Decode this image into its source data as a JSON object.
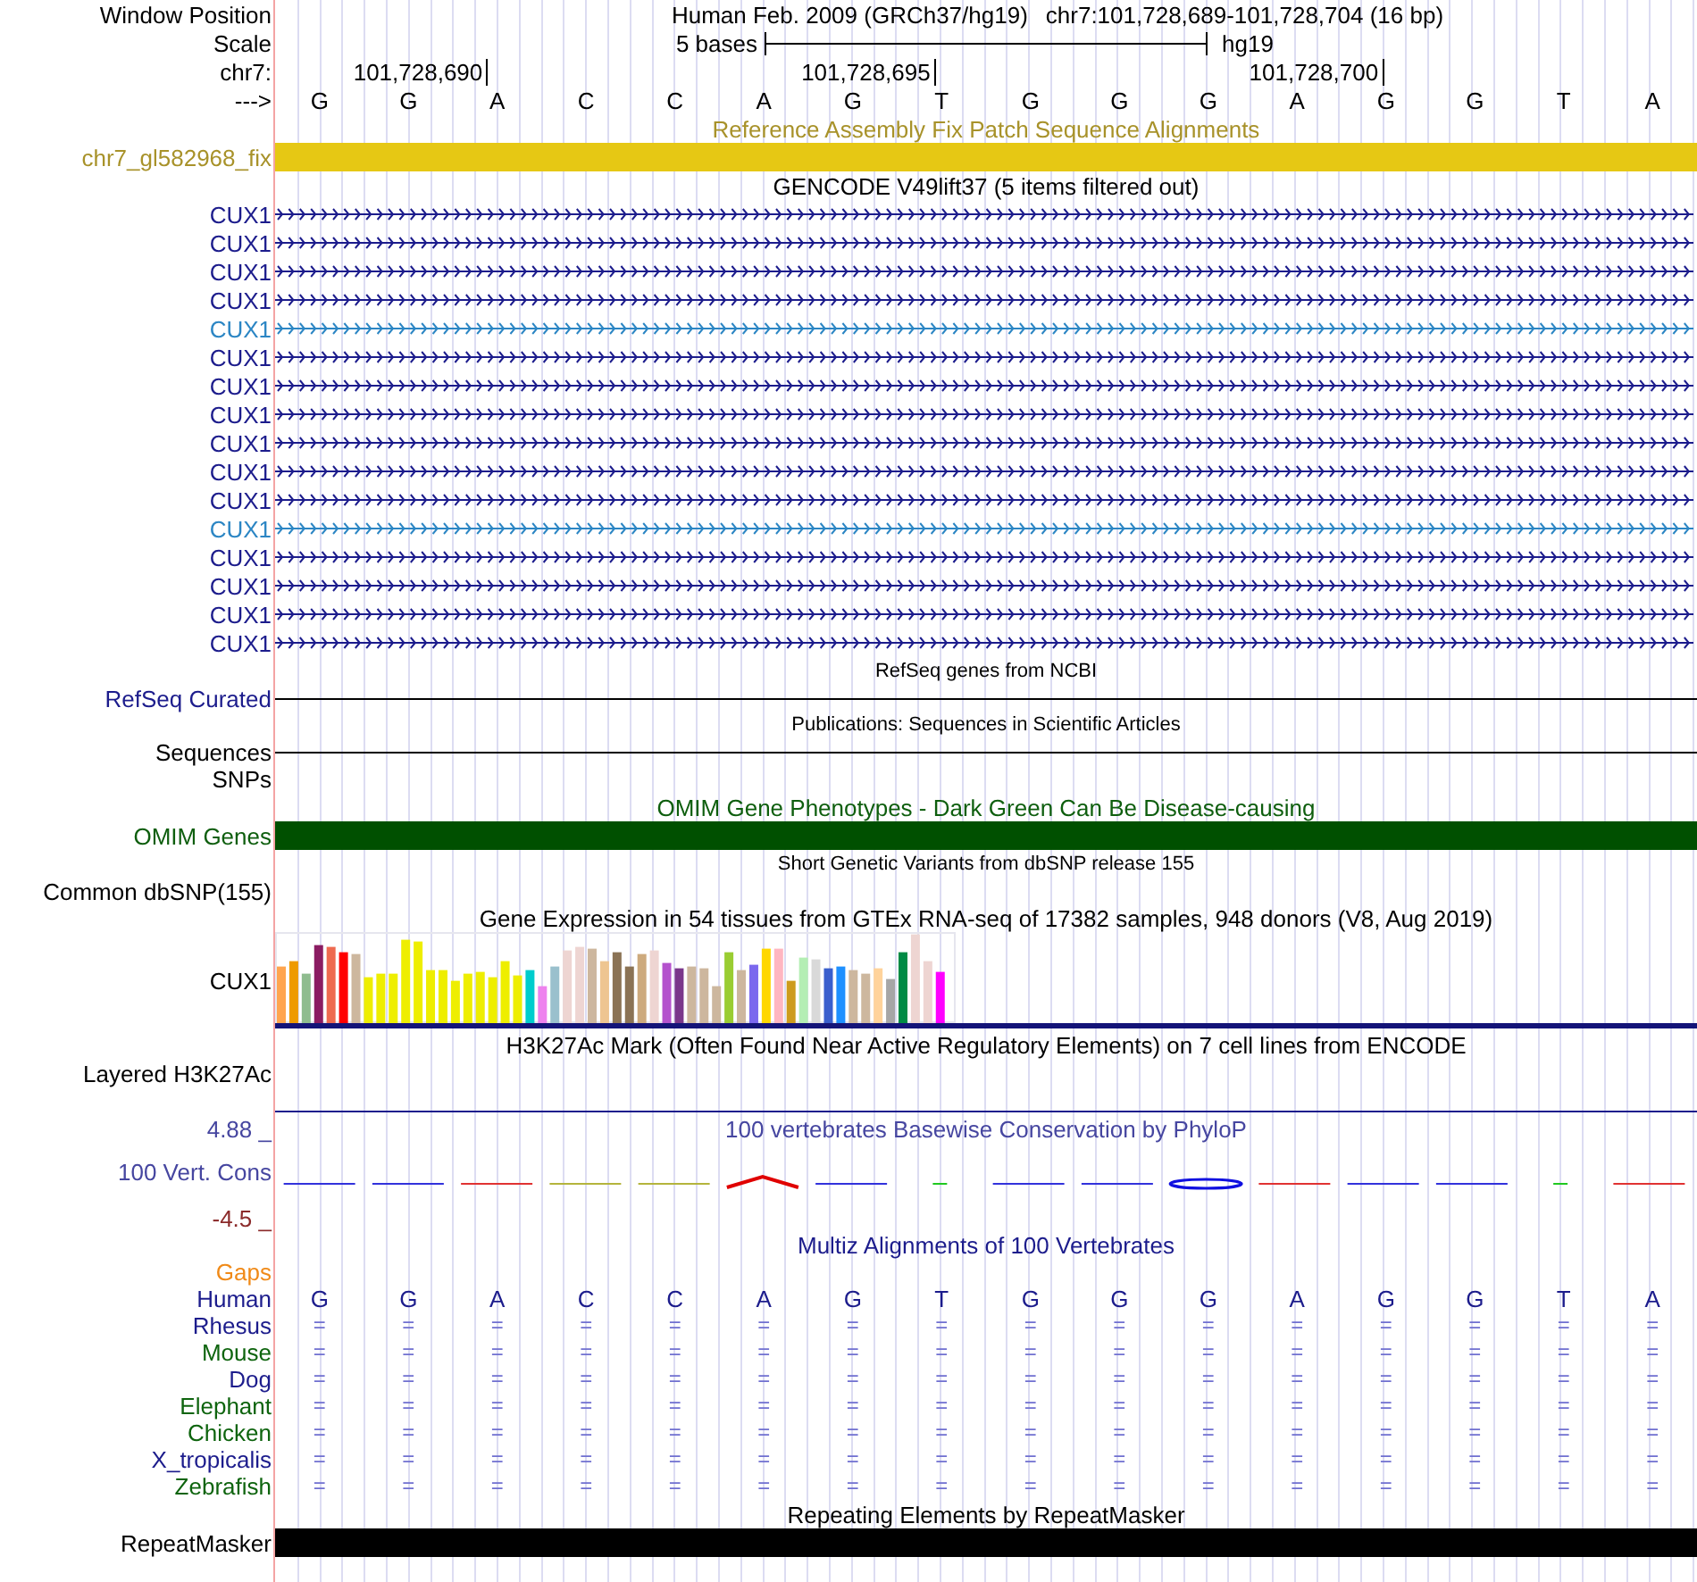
{
  "header": {
    "window_position_label": "Window Position",
    "assembly": "Human Feb. 2009 (GRCh37/hg19)",
    "position": "chr7:101,728,689-101,728,704 (16 bp)",
    "scale_label": "Scale",
    "scale_text": "5 bases",
    "scale_db": "hg19",
    "chrom_label": "chr7:",
    "ruler_ticks": [
      "101,728,690",
      "101,728,695",
      "101,728,700"
    ],
    "strand_label": "--->",
    "bases": [
      "G",
      "G",
      "A",
      "C",
      "C",
      "A",
      "G",
      "T",
      "G",
      "G",
      "G",
      "A",
      "G",
      "G",
      "T",
      "A"
    ]
  },
  "tracks": [
    {
      "kind": "bar",
      "title": "Reference Assembly Fix Patch Sequence Alignments",
      "label": "chr7_gl582968_fix",
      "color": "#a8922a",
      "bar": {
        "color": "#e6c814"
      }
    },
    {
      "kind": "genes",
      "title": "GENCODE V49lift37 (5 items filtered out)",
      "items": [
        {
          "name": "CUX1",
          "color": "#1c1c8c"
        },
        {
          "name": "CUX1",
          "color": "#1c1c8c"
        },
        {
          "name": "CUX1",
          "color": "#1c1c8c"
        },
        {
          "name": "CUX1",
          "color": "#1c1c8c"
        },
        {
          "name": "CUX1",
          "color": "#2c86c4"
        },
        {
          "name": "CUX1",
          "color": "#1c1c8c"
        },
        {
          "name": "CUX1",
          "color": "#1c1c8c"
        },
        {
          "name": "CUX1",
          "color": "#1c1c8c"
        },
        {
          "name": "CUX1",
          "color": "#1c1c8c"
        },
        {
          "name": "CUX1",
          "color": "#1c1c8c"
        },
        {
          "name": "CUX1",
          "color": "#1c1c8c"
        },
        {
          "name": "CUX1",
          "color": "#2c86c4"
        },
        {
          "name": "CUX1",
          "color": "#1c1c8c"
        },
        {
          "name": "CUX1",
          "color": "#1c1c8c"
        },
        {
          "name": "CUX1",
          "color": "#1c1c8c"
        },
        {
          "name": "CUX1",
          "color": "#1c1c8c"
        }
      ]
    },
    {
      "kind": "line",
      "title": "RefSeq genes from NCBI",
      "labels": [
        "RefSeq Curated"
      ],
      "color": "#1c1c8c"
    },
    {
      "kind": "line",
      "title": "Publications: Sequences in Scientific Articles",
      "labels": [
        "Sequences",
        "SNPs"
      ],
      "color": "#000000"
    },
    {
      "kind": "bar",
      "title": "OMIM Gene Phenotypes - Dark Green Can Be Disease-causing",
      "label": "OMIM Genes",
      "color": "#0e5e0e",
      "bar": {
        "color": "#005000"
      }
    },
    {
      "kind": "empty",
      "title": "Short Genetic Variants from dbSNP release 155",
      "labels": [
        "Common dbSNP(155)"
      ],
      "color": "#000000"
    },
    {
      "kind": "expression",
      "title": "Gene Expression in 54 tissues from GTEx RNA-seq of 17382 samples, 948 donors (V8, Aug 2019)",
      "label": "CUX1"
    },
    {
      "kind": "signal",
      "title": "H3K27Ac Mark (Often Found Near Active Regulatory Elements) on 7 cell lines from ENCODE",
      "label": "Layered H3K27Ac"
    },
    {
      "kind": "conservation",
      "title": "100 vertebrates Basewise Conservation by PhyloP",
      "label": "100 Vert. Cons",
      "max_label": "4.88 _",
      "min_label": "-4.5 _",
      "color": "#4646a0"
    },
    {
      "kind": "alignment",
      "title": "Multiz Alignments of 100 Vertebrates",
      "gaps_label": "Gaps",
      "species": [
        {
          "name": "Human",
          "color": "#1c1c8c",
          "bases": [
            "G",
            "G",
            "A",
            "C",
            "C",
            "A",
            "G",
            "T",
            "G",
            "G",
            "G",
            "A",
            "G",
            "G",
            "T",
            "A"
          ]
        },
        {
          "name": "Rhesus",
          "color": "#1c1c8c",
          "bases": [
            "=",
            "=",
            "=",
            "=",
            "=",
            "=",
            "=",
            "=",
            "=",
            "=",
            "=",
            "=",
            "=",
            "=",
            "=",
            "="
          ]
        },
        {
          "name": "Mouse",
          "color": "#0e640e",
          "bases": [
            "=",
            "=",
            "=",
            "=",
            "=",
            "=",
            "=",
            "=",
            "=",
            "=",
            "=",
            "=",
            "=",
            "=",
            "=",
            "="
          ]
        },
        {
          "name": "Dog",
          "color": "#1c1c8c",
          "bases": [
            "=",
            "=",
            "=",
            "=",
            "=",
            "=",
            "=",
            "=",
            "=",
            "=",
            "=",
            "=",
            "=",
            "=",
            "=",
            "="
          ]
        },
        {
          "name": "Elephant",
          "color": "#0e640e",
          "bases": [
            "=",
            "=",
            "=",
            "=",
            "=",
            "=",
            "=",
            "=",
            "=",
            "=",
            "=",
            "=",
            "=",
            "=",
            "=",
            "="
          ]
        },
        {
          "name": "Chicken",
          "color": "#0e640e",
          "bases": [
            "=",
            "=",
            "=",
            "=",
            "=",
            "=",
            "=",
            "=",
            "=",
            "=",
            "=",
            "=",
            "=",
            "=",
            "=",
            "="
          ]
        },
        {
          "name": "X_tropicalis",
          "color": "#1c1c8c",
          "bases": [
            "=",
            "=",
            "=",
            "=",
            "=",
            "=",
            "=",
            "=",
            "=",
            "=",
            "=",
            "=",
            "=",
            "=",
            "=",
            "="
          ]
        },
        {
          "name": "Zebrafish",
          "color": "#0e640e",
          "bases": [
            "=",
            "=",
            "=",
            "=",
            "=",
            "=",
            "=",
            "=",
            "=",
            "=",
            "=",
            "=",
            "=",
            "=",
            "=",
            "="
          ]
        }
      ]
    },
    {
      "kind": "bar",
      "title": "Repeating Elements by RepeatMasker",
      "label": "RepeatMasker",
      "color": "#000000",
      "bar": {
        "color": "#000000"
      }
    }
  ]
}
